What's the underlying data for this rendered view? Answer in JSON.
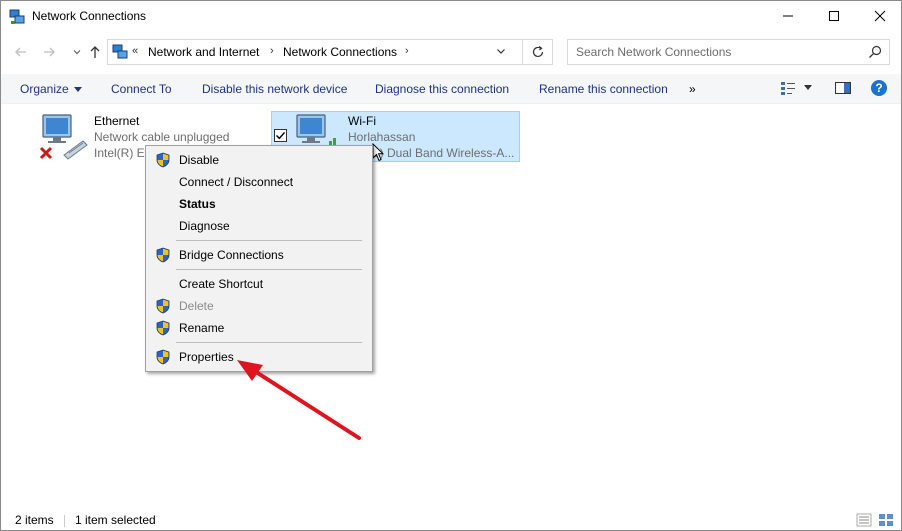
{
  "window": {
    "title": "Network Connections",
    "controls": {
      "minimize": "minimize",
      "maximize": "maximize",
      "close": "close"
    }
  },
  "address": {
    "overflow": "«",
    "crumbs": [
      "Network and Internet",
      "Network Connections"
    ],
    "search_placeholder": "Search Network Connections"
  },
  "commands": {
    "organize": "Organize",
    "connect_to": "Connect To",
    "disable_device": "Disable this network device",
    "diagnose": "Diagnose this connection",
    "rename": "Rename this connection",
    "more": "»"
  },
  "connections": [
    {
      "name": "Ethernet",
      "status": "Network cable unplugged",
      "adapter": "Intel(R) Et"
    },
    {
      "name": "Wi-Fi",
      "status": "Horlahassan",
      "adapter": "2) Dual Band Wireless-A..."
    }
  ],
  "context_menu": {
    "items": [
      {
        "label": "Disable",
        "shield": true,
        "bold": false,
        "disabled": false
      },
      {
        "label": "Connect / Disconnect",
        "shield": false,
        "bold": false,
        "disabled": false
      },
      {
        "label": "Status",
        "shield": false,
        "bold": true,
        "disabled": false
      },
      {
        "label": "Diagnose",
        "shield": false,
        "bold": false,
        "disabled": false
      },
      {
        "label": "Bridge Connections",
        "shield": true,
        "bold": false,
        "disabled": false
      },
      {
        "label": "Create Shortcut",
        "shield": false,
        "bold": false,
        "disabled": false
      },
      {
        "label": "Delete",
        "shield": true,
        "bold": false,
        "disabled": true
      },
      {
        "label": "Rename",
        "shield": true,
        "bold": false,
        "disabled": false
      },
      {
        "label": "Properties",
        "shield": true,
        "bold": false,
        "disabled": false
      }
    ]
  },
  "status_bar": {
    "count": "2 items",
    "selected": "1 item selected"
  },
  "colors": {
    "accent": "#1e3287",
    "selection_bg": "#cce8ff",
    "selection_border": "#99d1ff",
    "annotation_arrow": "#e0141e"
  },
  "icons": {
    "app": "network-connections-icon",
    "help": "help-icon",
    "view": "change-view-icon",
    "preview": "preview-pane-icon"
  }
}
